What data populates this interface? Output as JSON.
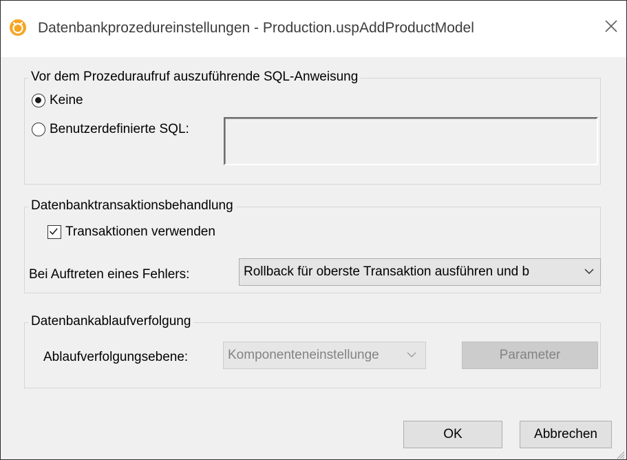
{
  "window": {
    "title": "Datenbankprozedureinstellungen - Production.uspAddProductModel",
    "app_icon": "altova-mapforce-icon",
    "accent_color": "#f5a623"
  },
  "pre_sql": {
    "legend": "Vor dem Prozeduraufruf auszuführende SQL-Anweisung",
    "option_none": "Keine",
    "option_custom": "Benutzerdefinierte SQL:",
    "selected": "Keine",
    "custom_sql_value": ""
  },
  "transactions": {
    "legend": "Datenbanktransaktionsbehandlung",
    "use_transactions_label": "Transaktionen verwenden",
    "use_transactions_checked": true,
    "on_error_label": "Bei Auftreten eines Fehlers:",
    "on_error_value": "Rollback für oberste Transaktion ausführen und b"
  },
  "tracing": {
    "legend": "Datenbankablaufverfolgung",
    "level_label": "Ablaufverfolgungsebene:",
    "level_value": "Komponenteneinstellunge",
    "parameter_button": "Parameter"
  },
  "footer": {
    "ok_button": "OK",
    "cancel_button": "Abbrechen"
  }
}
